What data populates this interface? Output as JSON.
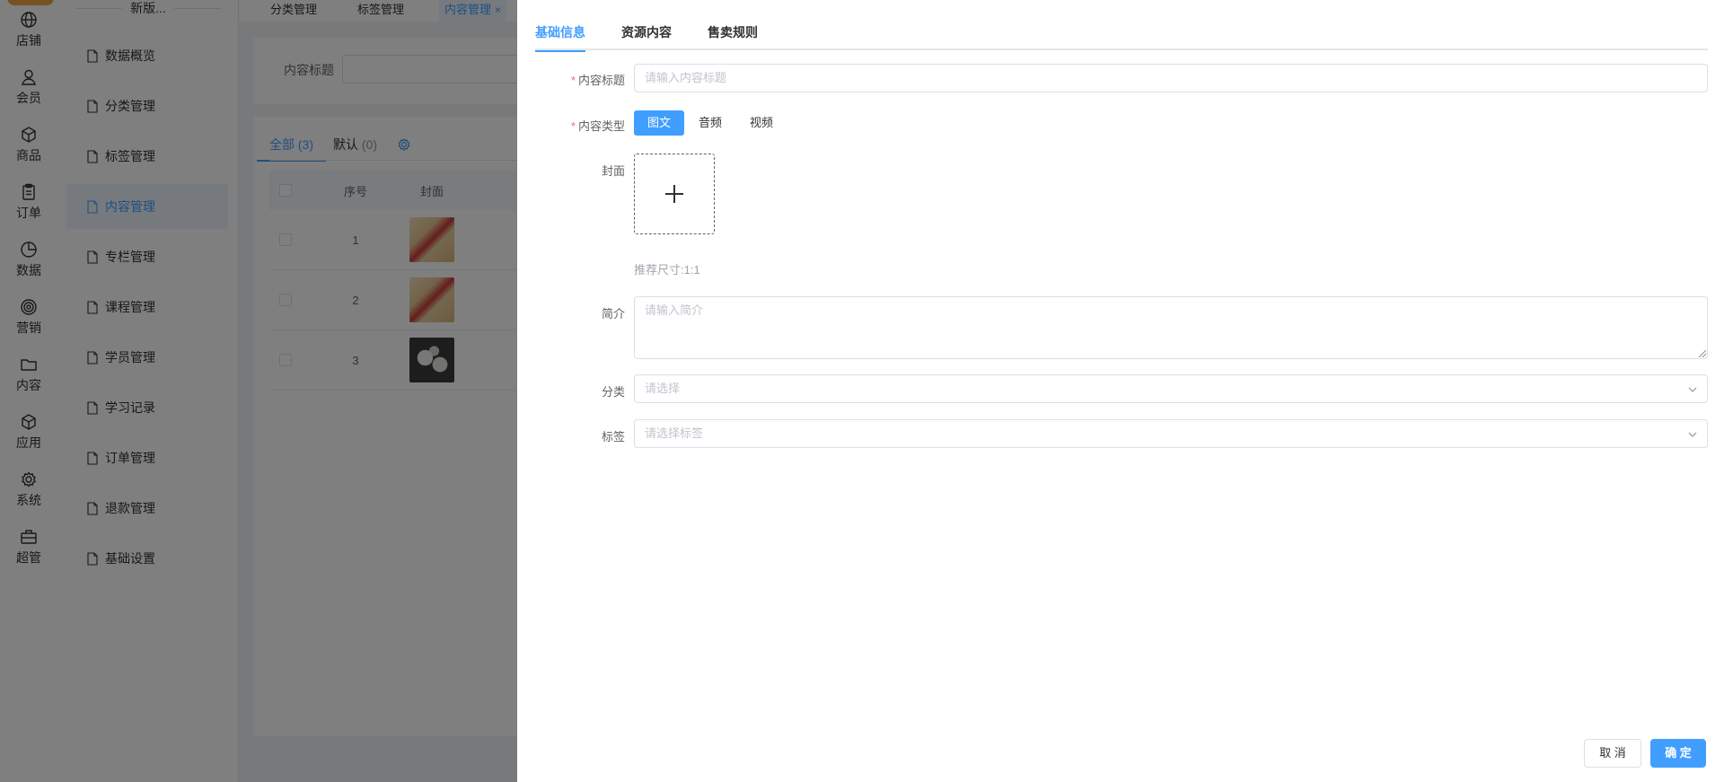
{
  "rail": {
    "items": [
      {
        "label": "店铺",
        "icon": "globe-icon"
      },
      {
        "label": "会员",
        "icon": "user-icon"
      },
      {
        "label": "商品",
        "icon": "box-icon"
      },
      {
        "label": "订单",
        "icon": "clipboard-icon"
      },
      {
        "label": "数据",
        "icon": "pie-chart-icon"
      },
      {
        "label": "营销",
        "icon": "target-icon"
      },
      {
        "label": "内容",
        "icon": "folder-icon"
      },
      {
        "label": "应用",
        "icon": "cube-icon"
      },
      {
        "label": "系统",
        "icon": "gear-icon"
      },
      {
        "label": "超管",
        "icon": "briefcase-icon"
      }
    ]
  },
  "subnav": {
    "title": "新版...",
    "items": [
      {
        "label": "数据概览"
      },
      {
        "label": "分类管理"
      },
      {
        "label": "标签管理"
      },
      {
        "label": "内容管理",
        "active": true
      },
      {
        "label": "专栏管理"
      },
      {
        "label": "课程管理"
      },
      {
        "label": "学员管理"
      },
      {
        "label": "学习记录"
      },
      {
        "label": "订单管理"
      },
      {
        "label": "退款管理"
      },
      {
        "label": "基础设置"
      }
    ]
  },
  "top_tabs": [
    {
      "label": "分类管理"
    },
    {
      "label": "标签管理"
    },
    {
      "label": "内容管理",
      "active": true,
      "close": "×"
    }
  ],
  "search": {
    "label": "内容标题"
  },
  "list": {
    "tabs": [
      {
        "label": "全部",
        "count": "(3)",
        "active": true
      },
      {
        "label": "默认",
        "count": "(0)"
      }
    ],
    "columns": [
      "序号",
      "封面"
    ],
    "rows": [
      {
        "index": "1",
        "cover": "warm"
      },
      {
        "index": "2",
        "cover": "warm"
      },
      {
        "index": "3",
        "cover": "dark"
      }
    ]
  },
  "drawer": {
    "tabs": [
      {
        "label": "基础信息",
        "active": true
      },
      {
        "label": "资源内容"
      },
      {
        "label": "售卖规则"
      }
    ],
    "form": {
      "title_label": "内容标题",
      "title_placeholder": "请输入内容标题",
      "type_label": "内容类型",
      "types": [
        {
          "label": "图文",
          "active": true
        },
        {
          "label": "音频"
        },
        {
          "label": "视频"
        }
      ],
      "cover_label": "封面",
      "cover_hint": "推荐尺寸:1:1",
      "intro_label": "简介",
      "intro_placeholder": "请输入简介",
      "category_label": "分类",
      "category_placeholder": "请选择",
      "tags_label": "标签",
      "tags_placeholder": "请选择标签",
      "required_mark": "*"
    },
    "buttons": {
      "cancel": "取 消",
      "confirm": "确 定"
    }
  },
  "colors": {
    "primary": "#409eff",
    "mask": "rgba(0,0,0,0.5)",
    "required": "#f56c6c"
  }
}
